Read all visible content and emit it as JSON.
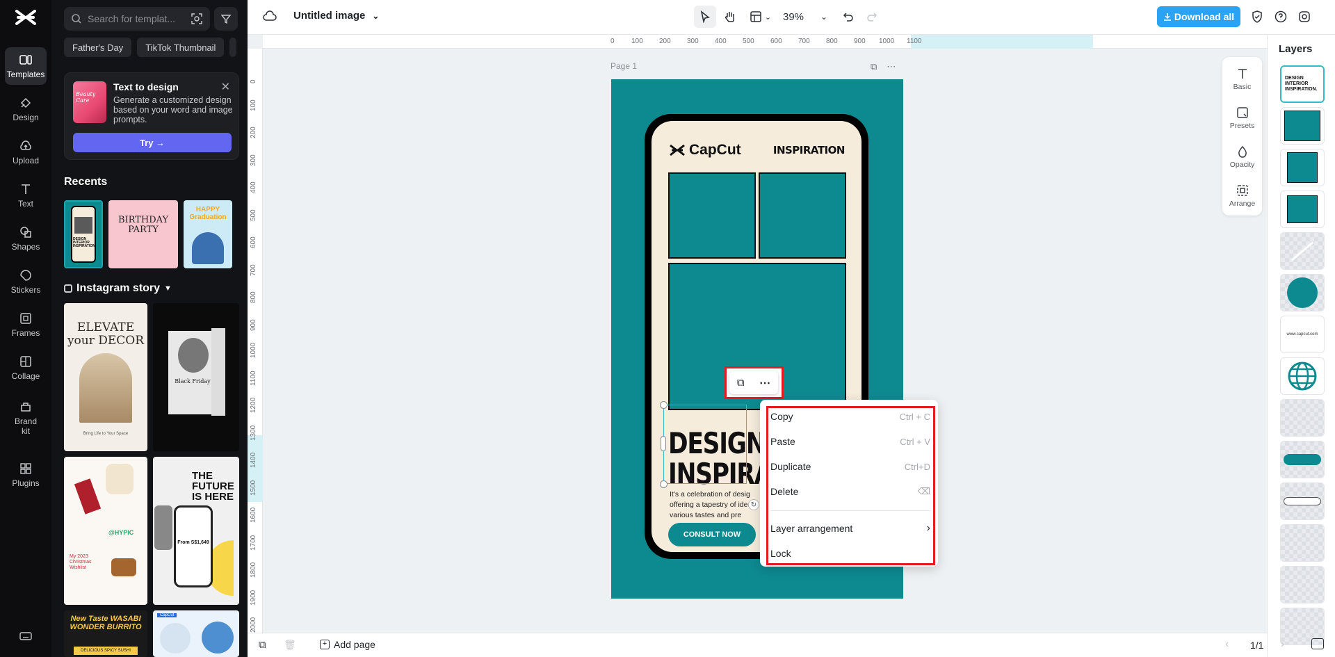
{
  "rail": {
    "items": [
      {
        "label": "Templates",
        "icon": "templates-icon"
      },
      {
        "label": "Design",
        "icon": "design-icon"
      },
      {
        "label": "Upload",
        "icon": "upload-icon"
      },
      {
        "label": "Text",
        "icon": "text-icon"
      },
      {
        "label": "Shapes",
        "icon": "shapes-icon"
      },
      {
        "label": "Stickers",
        "icon": "stickers-icon"
      },
      {
        "label": "Frames",
        "icon": "frames-icon"
      },
      {
        "label": "Collage",
        "icon": "collage-icon"
      },
      {
        "label": "Brand kit",
        "icon": "brand-kit-icon"
      },
      {
        "label": "Plugins",
        "icon": "plugins-icon"
      }
    ]
  },
  "panel": {
    "search_placeholder": "Search for templat...",
    "chips": [
      "Father's Day",
      "TikTok Thumbnail"
    ],
    "text_to_design": {
      "title": "Text to design",
      "description": "Generate a customized design based on your word and image prompts.",
      "thumb_text": "Beauty Care",
      "try_label": "Try →"
    },
    "recents_title": "Recents",
    "recents": [
      "DESIGN INTERIOR INSPIRATION.",
      "BIRTHDAY PARTY",
      "HAPPY Graduation"
    ],
    "category_title": "Instagram story",
    "templates": [
      {
        "title": "ELEVATE your DECOR",
        "caption": "Bring Life to Your Space"
      },
      {
        "title": "Black Friday"
      },
      {
        "title": "My 2023 Christmas Wishlist",
        "caption": "@HYPIC"
      },
      {
        "title": "THE FUTURE IS HERE",
        "caption": "From S$1,649"
      },
      {
        "title": "New Taste WASABI WONDER BURRITO",
        "caption": "DELICIOUS SPICY SUSHI"
      },
      {
        "title": "CapCut"
      }
    ]
  },
  "topbar": {
    "doc_title": "Untitled image",
    "zoom": "39%",
    "download_label": "Download all"
  },
  "canvas": {
    "ruler_h": [
      "0",
      "100",
      "200",
      "300",
      "400",
      "500",
      "600",
      "700",
      "800",
      "900",
      "1000",
      "1100"
    ],
    "ruler_v": [
      "0",
      "100",
      "200",
      "300",
      "400",
      "500",
      "600",
      "700",
      "800",
      "900",
      "1000",
      "1100",
      "1200",
      "1300",
      "1400",
      "1500",
      "1600",
      "1700",
      "1800",
      "1900",
      "2000"
    ],
    "page_label": "Page 1",
    "design": {
      "brand": "CapCut",
      "inspiration": "INSPIRATION",
      "title_line1": "DESIGN II",
      "title_line2": "INSPIRAT",
      "body_line1": "It's a celebration of desig",
      "body_line2": "offering a tapestry of idea",
      "body_line3": "various tastes and pre",
      "button": "CONSULT NOW"
    }
  },
  "context_menu": {
    "items": [
      {
        "label": "Copy",
        "shortcut": "Ctrl + C"
      },
      {
        "label": "Paste",
        "shortcut": "Ctrl + V"
      },
      {
        "label": "Duplicate",
        "shortcut": "Ctrl+D"
      },
      {
        "label": "Delete",
        "shortcut": "⌫"
      },
      {
        "label": "Layer arrangement",
        "shortcut": "›"
      },
      {
        "label": "Lock",
        "shortcut": ""
      }
    ]
  },
  "props_panel": [
    "Basic",
    "Presets",
    "Opacity",
    "Arrange"
  ],
  "layers": {
    "title": "Layers",
    "first_thumb_text": "DESIGN INTERIOR INSPIRATION.",
    "url_thumb_text": "www.capcut.com"
  },
  "bottombar": {
    "add_page": "Add page",
    "page_indicator": "1/1"
  },
  "colors": {
    "accent_teal": "#0d8a90",
    "download_blue": "#2aa3f5",
    "highlight_red": "#e31b23",
    "try_purple": "#6366f1"
  }
}
